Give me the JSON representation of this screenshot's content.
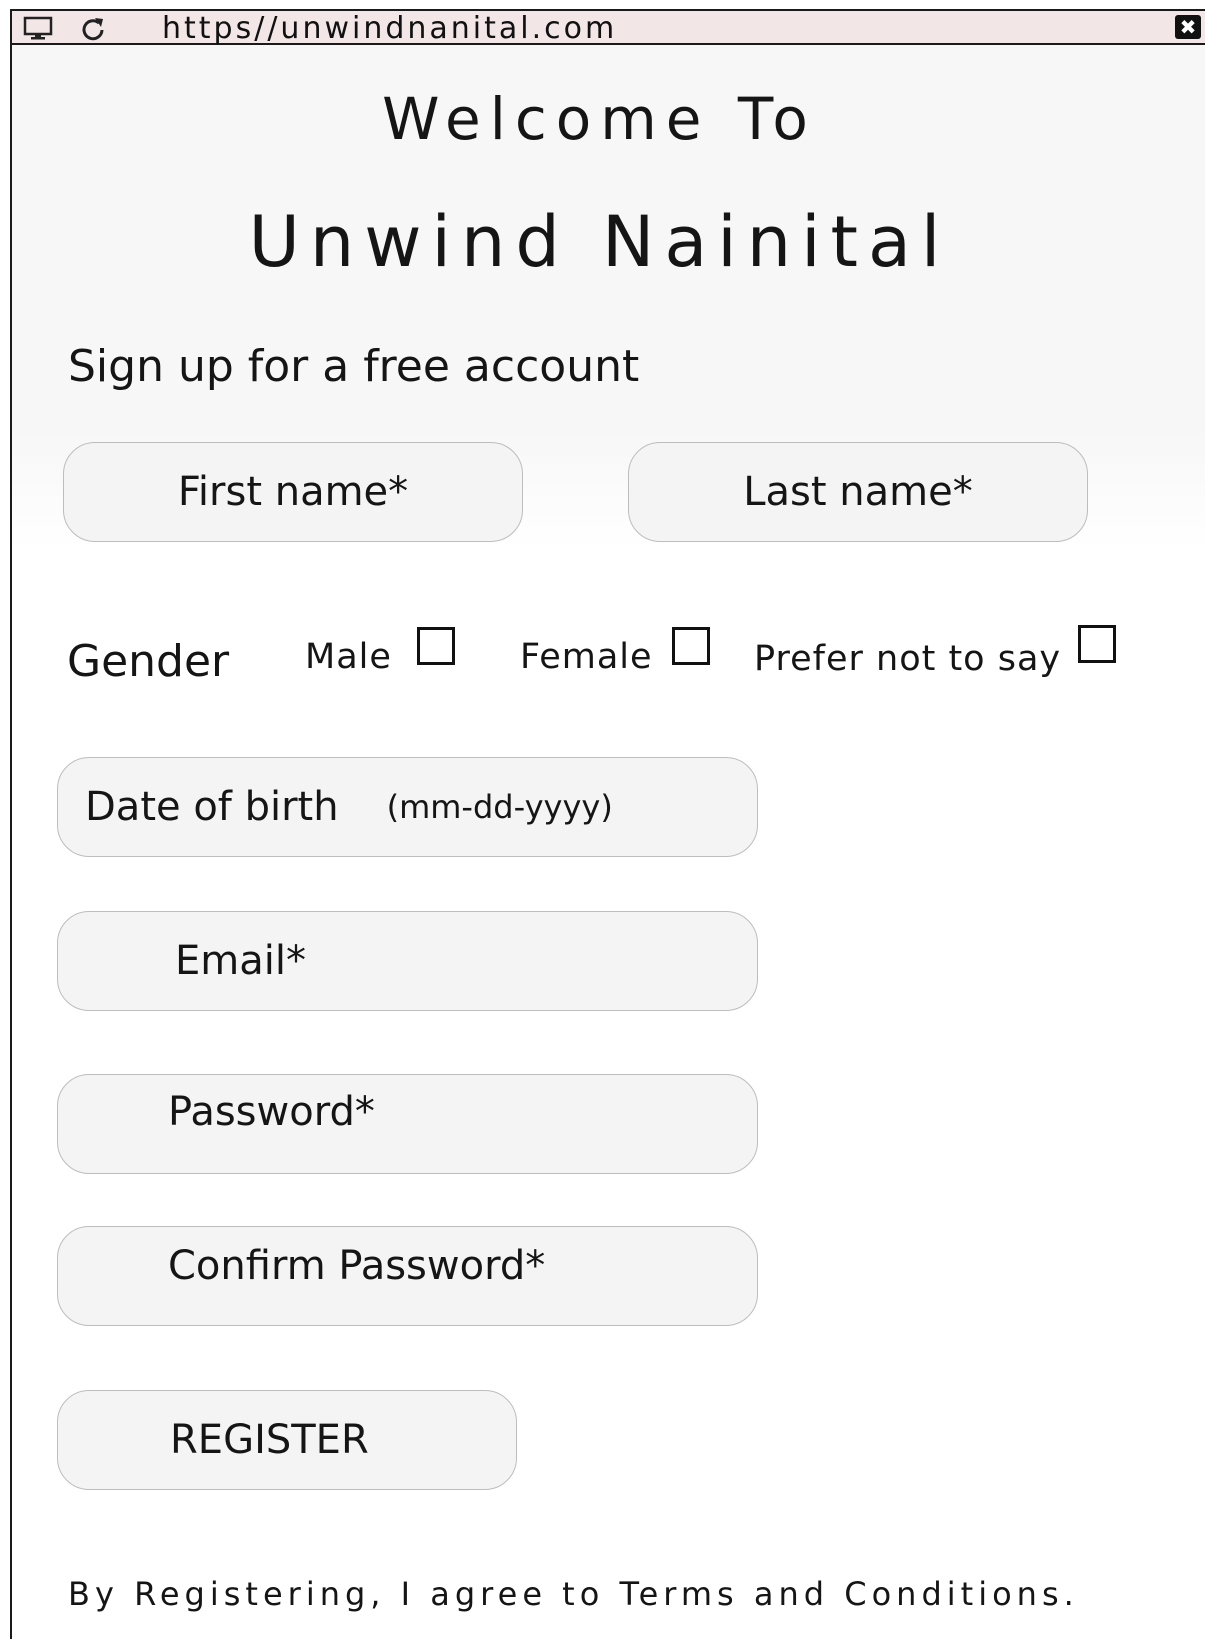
{
  "browser": {
    "url": "https//unwindnanital.com",
    "monitor_icon": "monitor-icon",
    "reload_icon": "reload-icon",
    "close_icon": "close-icon",
    "close_glyph": "✖"
  },
  "header": {
    "welcome": "Welcome To",
    "brand": "Unwind Nainital",
    "subtitle": "Sign up for a free account"
  },
  "form": {
    "first_name": "First name*",
    "last_name": "Last name*",
    "gender": {
      "label": "Gender",
      "options": [
        {
          "label": "Male",
          "checked": false
        },
        {
          "label": "Female",
          "checked": false
        },
        {
          "label": "Prefer not to say",
          "checked": false
        }
      ]
    },
    "dob": {
      "label": "Date of birth",
      "hint": "(mm-dd-yyyy)"
    },
    "email": "Email*",
    "password": "Password*",
    "confirm_password": "Confirm Password*",
    "register": "REGISTER"
  },
  "footer": {
    "terms": "By Registering, I agree to Terms and Conditions."
  },
  "colors": {
    "titlebar": "#f2e6e7",
    "field_bg": "#f4f4f4",
    "field_border": "#bdbdbd",
    "text": "#151515"
  }
}
